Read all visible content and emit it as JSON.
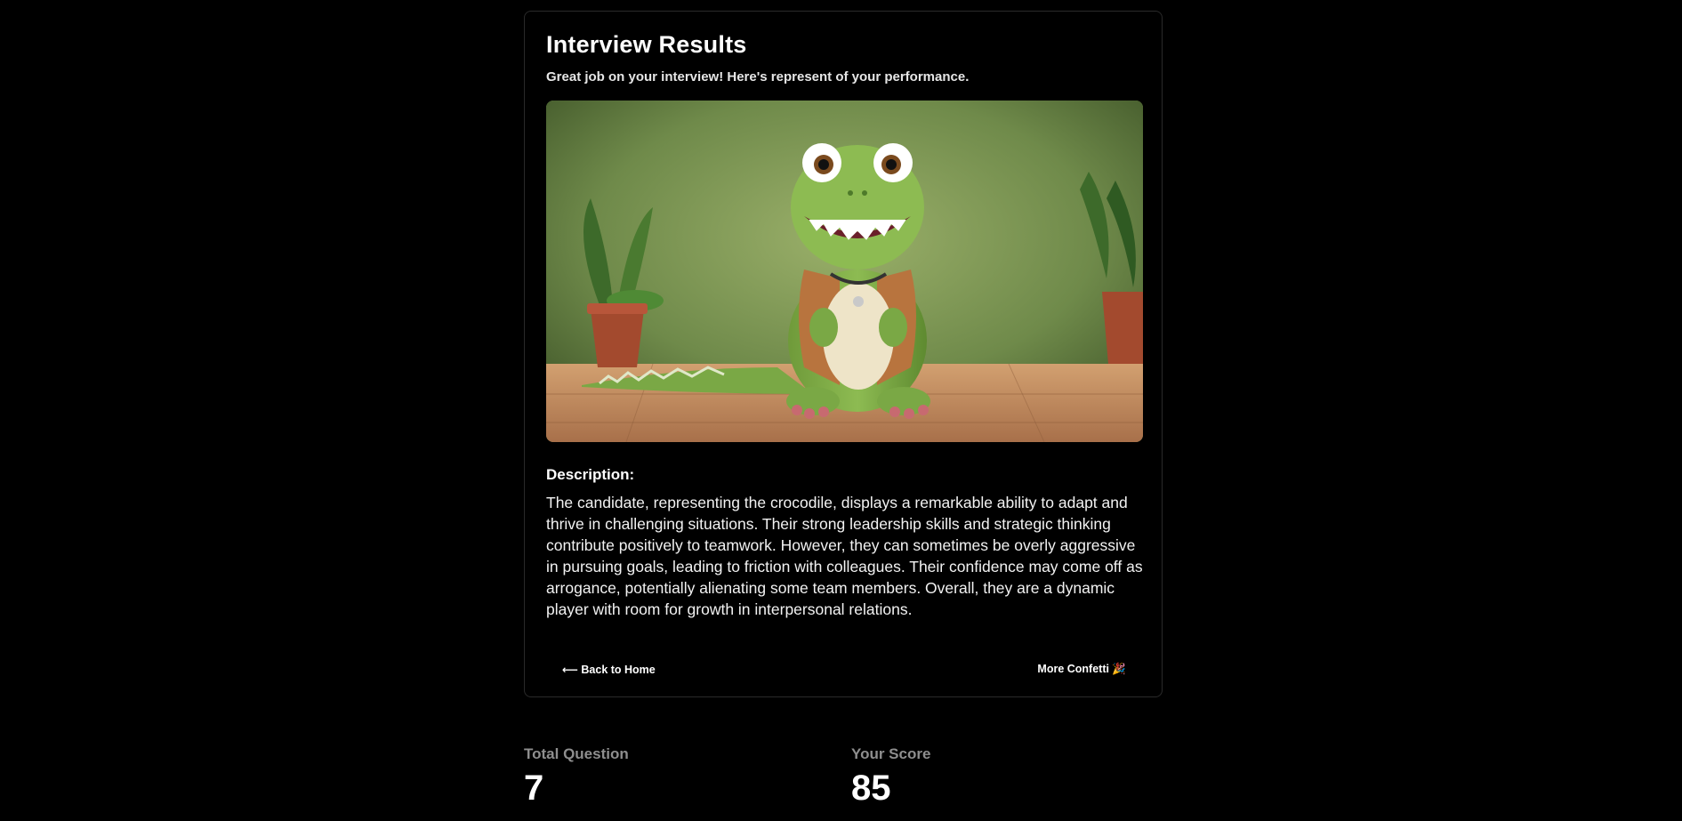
{
  "card": {
    "title": "Interview Results",
    "subtitle": "Great job on your interview! Here's represent of your performance.",
    "image_subject": "cartoon crocodile in a vest",
    "description_heading": "Description:",
    "description_text": "The candidate, representing the crocodile, displays a remarkable ability to adapt and thrive in challenging situations. Their strong leadership skills and strategic thinking contribute positively to teamwork. However, they can sometimes be overly aggressive in pursuing goals, leading to friction with colleagues. Their confidence may come off as arrogance, potentially alienating some team members. Overall, they are a dynamic player with room for growth in interpersonal relations.",
    "back_button_label": "⟵ Back to Home",
    "confetti_button_label": "More Confetti 🎉"
  },
  "stats": {
    "total_question_label": "Total Question",
    "total_question_value": "7",
    "score_label": "Your Score",
    "score_value": "85"
  },
  "colors": {
    "background": "#000000",
    "card_border": "#2a2a2a",
    "muted_label": "#8e8e8e"
  }
}
